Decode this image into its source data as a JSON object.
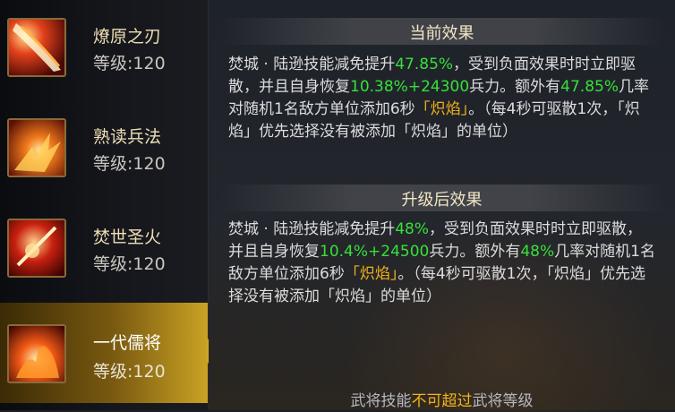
{
  "skills": [
    {
      "name": "燎原之刃",
      "level": "等级:120",
      "icon": "blade-fire-icon"
    },
    {
      "name": "熟读兵法",
      "level": "等级:120",
      "icon": "flame-scroll-icon"
    },
    {
      "name": "焚世圣火",
      "level": "等级:120",
      "icon": "holy-fire-icon"
    },
    {
      "name": "一代儒将",
      "level": "等级:120",
      "icon": "burning-figure-icon",
      "selected": true
    }
  ],
  "current": {
    "header": "当前效果",
    "p1": "焚城 · 陆逊技能减免提升",
    "v1": "47.85%",
    "p2": "，受到负面效果时时立即驱散，并且自身恢复",
    "v2": "10.38%+24300",
    "p3": "兵力。额外有",
    "v3": "47.85%",
    "p4": "几率对随机1名敌方单位添加6秒",
    "tag": "「炽焰」",
    "p5": "。（每4秒可驱散1次，「炽焰」优先选择没有被添加「炽焰」的单位）"
  },
  "upgrade": {
    "header": "升级后效果",
    "p1": "焚城 · 陆逊技能减免提升",
    "v1": "48%",
    "p2": "，受到负面效果时时立即驱散，并且自身恢复",
    "v2": "10.4%+24500",
    "p3": "兵力。额外有",
    "v3": "48%",
    "p4": "几率对随机1名敌方单位添加6秒",
    "tag": "「炽焰」",
    "p5": "。（每4秒可驱散1次，「炽焰」优先选择没有被添加「炽焰」的单位）"
  },
  "footer": {
    "a": "武将技能",
    "b": "不可超过",
    "c": "武将等级"
  },
  "colors": {
    "highlight": "#37e03a",
    "tag": "#f3b21a",
    "header": "#f2e6c4"
  }
}
